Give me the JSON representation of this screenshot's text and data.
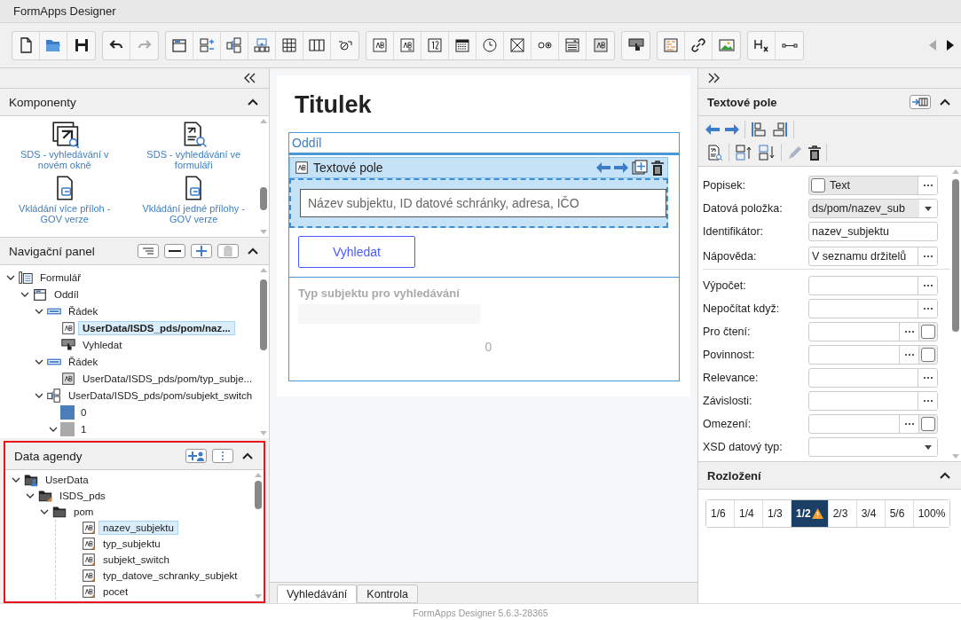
{
  "window": {
    "title": "FormApps Designer"
  },
  "toolbar": {
    "groups": [
      [
        {
          "kind": "new",
          "disabled": false
        },
        {
          "kind": "open",
          "disabled": false
        },
        {
          "kind": "save",
          "disabled": false
        }
      ],
      [
        {
          "kind": "undo",
          "disabled": false
        },
        {
          "kind": "redo",
          "disabled": true
        }
      ],
      [
        {
          "kind": "section",
          "disabled": false
        },
        {
          "kind": "addrow",
          "disabled": false
        },
        {
          "kind": "switch",
          "disabled": false
        },
        {
          "kind": "repeat",
          "disabled": false
        },
        {
          "kind": "table",
          "disabled": false
        },
        {
          "kind": "columns",
          "disabled": false
        },
        {
          "kind": "hide",
          "disabled": false
        }
      ],
      [
        {
          "kind": "text",
          "disabled": false
        },
        {
          "kind": "textxy",
          "disabled": false
        },
        {
          "kind": "number",
          "disabled": false
        },
        {
          "kind": "date",
          "disabled": false
        },
        {
          "kind": "time",
          "disabled": false
        },
        {
          "kind": "checkbox",
          "disabled": false
        },
        {
          "kind": "radio",
          "disabled": false
        },
        {
          "kind": "dropdown",
          "disabled": false
        },
        {
          "kind": "textro",
          "disabled": false
        }
      ],
      [
        {
          "kind": "button",
          "disabled": false
        }
      ],
      [
        {
          "kind": "richtext",
          "disabled": false
        },
        {
          "kind": "link",
          "disabled": false
        },
        {
          "kind": "image",
          "disabled": false
        }
      ],
      [
        {
          "kind": "heading",
          "disabled": false
        },
        {
          "kind": "line",
          "disabled": false
        }
      ]
    ]
  },
  "components": {
    "title": "Komponenty",
    "expanded": true,
    "items": [
      {
        "label": "SDS - vyhledávání v novém okně",
        "kind": "window-search"
      },
      {
        "label": "SDS - vyhledávání ve formuláři",
        "kind": "doc-search"
      },
      {
        "label": "Vkládání více příloh - GOV verze",
        "kind": "attach"
      },
      {
        "label": "Vkládání jedné přílohy - GOV verze",
        "kind": "attach"
      }
    ]
  },
  "nav_panel": {
    "title": "Navigační panel",
    "expanded": true,
    "tree": [
      {
        "label": "Formulář",
        "kind": "form",
        "selected": false,
        "expanded": true,
        "children": [
          {
            "label": "Oddíl",
            "kind": "section",
            "selected": false,
            "expanded": true,
            "children": [
              {
                "label": "Řádek",
                "kind": "row",
                "selected": false,
                "expanded": true,
                "children": [
                  {
                    "label": "UserData/ISDS_pds/pom/naz...",
                    "kind": "text",
                    "selected": true
                  },
                  {
                    "label": "Vyhledat",
                    "kind": "button",
                    "selected": false
                  }
                ]
              },
              {
                "label": "Řádek",
                "kind": "row",
                "selected": false,
                "expanded": true,
                "children": [
                  {
                    "label": "UserData/ISDS_pds/pom/typ_subje...",
                    "kind": "textro",
                    "selected": false
                  }
                ]
              },
              {
                "label": "UserData/ISDS_pds/pom/subjekt_switch",
                "kind": "switch",
                "selected": false,
                "expanded": true,
                "children": [
                  {
                    "label": "0",
                    "kind": "swatch",
                    "color": "#4a7ebb",
                    "selected": false
                  },
                  {
                    "label": "1",
                    "kind": "swatch",
                    "color": "#aaaaaa",
                    "selected": false,
                    "expanded": true
                  }
                ]
              }
            ]
          }
        ]
      }
    ]
  },
  "data_panel": {
    "title": "Data agendy",
    "expanded": true,
    "highlighted": true,
    "tree": [
      {
        "label": "UserData",
        "kind": "userfolder",
        "selected": false,
        "expanded": true,
        "children": [
          {
            "label": "ISDS_pds",
            "kind": "datafolder",
            "selected": false,
            "expanded": true,
            "children": [
              {
                "label": "pom",
                "kind": "folder",
                "selected": false,
                "expanded": true,
                "children": [
                  {
                    "label": "nazev_subjektu",
                    "kind": "field",
                    "selected": true
                  },
                  {
                    "label": "typ_subjektu",
                    "kind": "field",
                    "selected": false
                  },
                  {
                    "label": "subjekt_switch",
                    "kind": "field",
                    "selected": false
                  },
                  {
                    "label": "typ_datove_schranky_subjekt",
                    "kind": "field",
                    "selected": false
                  },
                  {
                    "label": "pocet",
                    "kind": "field",
                    "selected": false
                  }
                ]
              }
            ]
          }
        ]
      }
    ]
  },
  "canvas": {
    "title": "Titulek",
    "section": "Oddíl",
    "field": {
      "label": "Textové pole",
      "selected": true,
      "placeholder": "Název subjektu, ID datové schránky, adresa, IČO"
    },
    "button": "Vyhledat",
    "field2": {
      "label": "Typ subjektu pro vyhledávání"
    },
    "counter": "0"
  },
  "tabs": [
    {
      "label": "Vyhledávání",
      "selected": true
    },
    {
      "label": "Kontrola",
      "selected": false
    }
  ],
  "properties": {
    "title": "Textové pole",
    "expanded": true,
    "rows": [
      {
        "label": "Popisek:",
        "kind": "checktext",
        "value": "Text",
        "checked": false,
        "disabled": true
      },
      {
        "label": "Datová položka:",
        "kind": "select",
        "value": "ds/pom/nazev_sub",
        "disabled": true
      },
      {
        "label": "Identifikátor:",
        "kind": "text",
        "value": "nazev_subjektu",
        "disabled": false
      },
      {
        "label": "Nápověda:",
        "kind": "dots",
        "value": "V seznamu držitelů",
        "disabled": false
      },
      {
        "label": "Výpočet:",
        "kind": "dots",
        "disabled": false
      },
      {
        "label": "Nepočítat když:",
        "kind": "dots",
        "disabled": false
      },
      {
        "label": "Pro čtení:",
        "kind": "dotscheck",
        "checked": false,
        "disabled": false
      },
      {
        "label": "Povinnost:",
        "kind": "dotscheck",
        "checked": false,
        "disabled": false
      },
      {
        "label": "Relevance:",
        "kind": "dots",
        "disabled": false
      },
      {
        "label": "Závislosti:",
        "kind": "dots",
        "disabled": false
      },
      {
        "label": "Omezení:",
        "kind": "dotscheck",
        "checked": false,
        "disabled": false
      },
      {
        "label": "XSD datový typ:",
        "kind": "select",
        "disabled": false
      }
    ]
  },
  "layout": {
    "title": "Rozložení",
    "expanded": true,
    "options": [
      {
        "label": "1/6",
        "selected": false,
        "warning": false
      },
      {
        "label": "1/4",
        "selected": false,
        "warning": false
      },
      {
        "label": "1/3",
        "selected": false,
        "warning": false
      },
      {
        "label": "1/2",
        "selected": true,
        "warning": true
      },
      {
        "label": "2/3",
        "selected": false,
        "warning": false
      },
      {
        "label": "3/4",
        "selected": false,
        "warning": false
      },
      {
        "label": "5/6",
        "selected": false,
        "warning": false
      },
      {
        "label": "100%",
        "selected": false,
        "warning": false
      }
    ]
  },
  "footer": "FormApps Designer 5.6.3-28365"
}
